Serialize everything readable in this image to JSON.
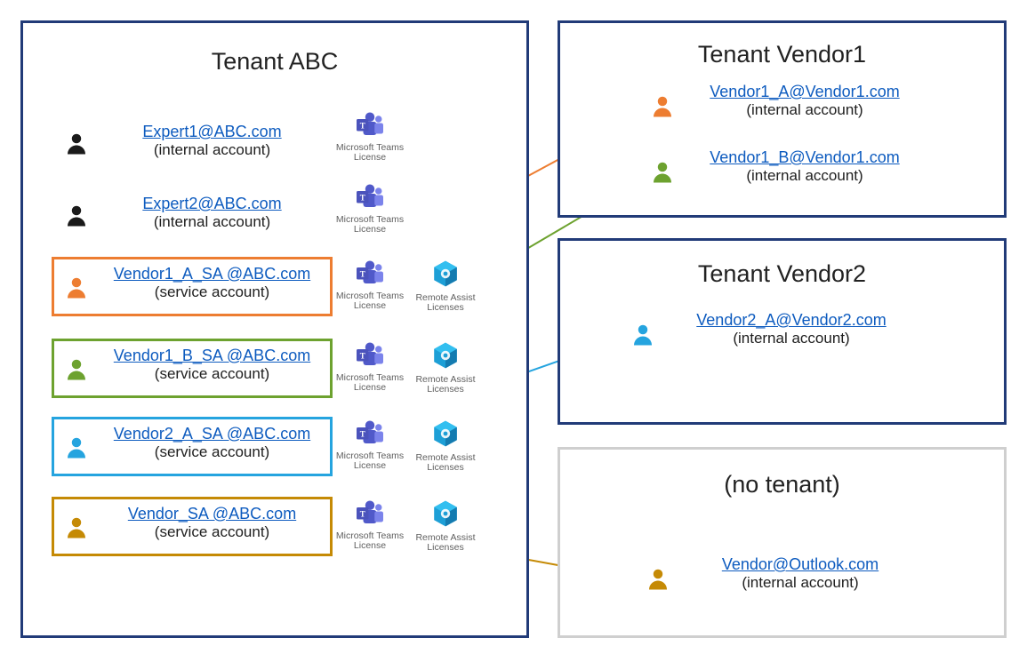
{
  "colors": {
    "orange": "#ed7d31",
    "green": "#6da22f",
    "blue": "#25a4df",
    "gold": "#c58a05",
    "black": "#1a1a1a",
    "navy": "#213b78",
    "link": "#0d5bbf"
  },
  "labels": {
    "internal": "(internal account)",
    "service": "(service account)",
    "teams_license": "Microsoft Teams License",
    "remote_assist": "Remote Assist Licenses"
  },
  "tenant_abc": {
    "title": "Tenant ABC",
    "experts": [
      {
        "id": "expert1",
        "email": "Expert1@ABC.com"
      },
      {
        "id": "expert2",
        "email": "Expert2@ABC.com"
      }
    ],
    "service_accounts": [
      {
        "id": "vendor1a_sa",
        "email": "Vendor1_A_SA @ABC.com",
        "color": "orange"
      },
      {
        "id": "vendor1b_sa",
        "email": "Vendor1_B_SA @ABC.com",
        "color": "green"
      },
      {
        "id": "vendor2a_sa",
        "email": "Vendor2_A_SA @ABC.com",
        "color": "blue"
      },
      {
        "id": "vendor_sa",
        "email": "Vendor_SA @ABC.com",
        "color": "gold"
      }
    ]
  },
  "tenant_vendor1": {
    "title": "Tenant Vendor1",
    "users": [
      {
        "id": "vendor1a",
        "email": "Vendor1_A@Vendor1.com",
        "color": "orange"
      },
      {
        "id": "vendor1b",
        "email": "Vendor1_B@Vendor1.com",
        "color": "green"
      }
    ]
  },
  "tenant_vendor2": {
    "title": "Tenant Vendor2",
    "users": [
      {
        "id": "vendor2a",
        "email": "Vendor2_A@Vendor2.com",
        "color": "blue"
      }
    ]
  },
  "no_tenant": {
    "title": "(no tenant)",
    "users": [
      {
        "id": "vendor_outlook",
        "email": "Vendor@Outlook.com",
        "color": "gold"
      }
    ]
  },
  "links": [
    {
      "from": "vendor1a_sa",
      "to": "vendor1a",
      "color": "orange"
    },
    {
      "from": "vendor1b_sa",
      "to": "vendor1b",
      "color": "green"
    },
    {
      "from": "vendor2a_sa",
      "to": "vendor2a",
      "color": "blue"
    },
    {
      "from": "vendor_sa",
      "to": "vendor_outlook",
      "color": "gold"
    }
  ],
  "chart_data": {
    "type": "diagram",
    "description": "Multi-tenant identity diagram showing service accounts in Tenant ABC mapped to corresponding internal accounts in vendor tenants (Vendor1, Vendor2) and an Outlook account with no tenant.",
    "tenants": [
      {
        "name": "Tenant ABC",
        "accounts": [
          {
            "email": "Expert1@ABC.com",
            "type": "internal",
            "color": "black",
            "licenses": [
              "Microsoft Teams License"
            ]
          },
          {
            "email": "Expert2@ABC.com",
            "type": "internal",
            "color": "black",
            "licenses": [
              "Microsoft Teams License"
            ]
          },
          {
            "email": "Vendor1_A_SA @ABC.com",
            "type": "service",
            "color": "orange",
            "licenses": [
              "Microsoft Teams License",
              "Remote Assist Licenses"
            ]
          },
          {
            "email": "Vendor1_B_SA @ABC.com",
            "type": "service",
            "color": "green",
            "licenses": [
              "Microsoft Teams License",
              "Remote Assist Licenses"
            ]
          },
          {
            "email": "Vendor2_A_SA @ABC.com",
            "type": "service",
            "color": "blue",
            "licenses": [
              "Microsoft Teams License",
              "Remote Assist Licenses"
            ]
          },
          {
            "email": "Vendor_SA @ABC.com",
            "type": "service",
            "color": "gold",
            "licenses": [
              "Microsoft Teams License",
              "Remote Assist Licenses"
            ]
          }
        ]
      },
      {
        "name": "Tenant Vendor1",
        "accounts": [
          {
            "email": "Vendor1_A@Vendor1.com",
            "type": "internal",
            "color": "orange"
          },
          {
            "email": "Vendor1_B@Vendor1.com",
            "type": "internal",
            "color": "green"
          }
        ]
      },
      {
        "name": "Tenant Vendor2",
        "accounts": [
          {
            "email": "Vendor2_A@Vendor2.com",
            "type": "internal",
            "color": "blue"
          }
        ]
      },
      {
        "name": "(no tenant)",
        "accounts": [
          {
            "email": "Vendor@Outlook.com",
            "type": "internal",
            "color": "gold"
          }
        ]
      }
    ],
    "mappings": [
      {
        "from": "Vendor1_A_SA @ABC.com",
        "to": "Vendor1_A@Vendor1.com",
        "color": "orange"
      },
      {
        "from": "Vendor1_B_SA @ABC.com",
        "to": "Vendor1_B@Vendor1.com",
        "color": "green"
      },
      {
        "from": "Vendor2_A_SA @ABC.com",
        "to": "Vendor2_A@Vendor2.com",
        "color": "blue"
      },
      {
        "from": "Vendor_SA @ABC.com",
        "to": "Vendor@Outlook.com",
        "color": "gold"
      }
    ]
  }
}
